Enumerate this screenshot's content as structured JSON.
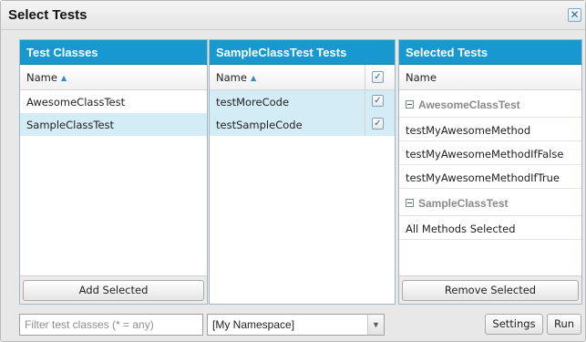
{
  "dialog": {
    "title": "Select Tests",
    "close_icon": "close-icon"
  },
  "left_panel": {
    "header": "Test Classes",
    "column": "Name",
    "rows": [
      {
        "label": "AwesomeClassTest",
        "selected": false
      },
      {
        "label": "SampleClassTest",
        "selected": true
      }
    ],
    "button": "Add Selected"
  },
  "middle_panel": {
    "header": "SampleClassTest Tests",
    "column": "Name",
    "rows": [
      {
        "label": "testMoreCode",
        "checked": true
      },
      {
        "label": "testSampleCode",
        "checked": true
      }
    ]
  },
  "right_panel": {
    "header": "Selected Tests",
    "column": "Name",
    "groups": [
      {
        "name": "AwesomeClassTest",
        "items": [
          "testMyAwesomeMethod",
          "testMyAwesomeMethodIfFalse",
          "testMyAwesomeMethodIfTrue"
        ]
      },
      {
        "name": "SampleClassTest",
        "items": [
          "All Methods Selected"
        ]
      }
    ],
    "button": "Remove Selected"
  },
  "bottom": {
    "filter_placeholder": "Filter test classes (* = any)",
    "namespace_value": "[My Namespace]",
    "settings_label": "Settings",
    "run_label": "Run"
  },
  "colors": {
    "accent": "#1798cf",
    "selection": "#d3ecf5"
  }
}
